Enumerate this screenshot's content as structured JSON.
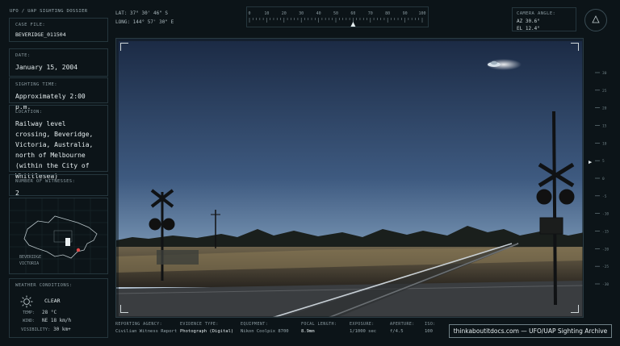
{
  "header": {
    "title": "UFO / UAP SIGHTING DOSSIER"
  },
  "fields": [
    {
      "label": "CASE FILE:",
      "value": "BEVERIDGE_011504"
    },
    {
      "label": "DATE:",
      "value": "January 15, 2004"
    },
    {
      "label": "SIGHTING TIME:",
      "value": "Approximately 2:00 p.m."
    },
    {
      "label": "LOCATION:",
      "value": "Railway level crossing, Beveridge, Victoria, Australia, north of Melbourne (within the City of Whittlesea)"
    },
    {
      "label": "NUMBER OF WITNESSES:",
      "value": "2"
    }
  ],
  "map": {
    "label_1": "BEVERIDGE",
    "label_2": "VICTORIA",
    "marker_color": "#e04848"
  },
  "weather": {
    "label": "WEATHER CONDITIONS:",
    "condition": "CLEAR",
    "temp_label": "TEMP:",
    "temp": "28 °C",
    "wind_label": "WIND:",
    "wind": "NE 18 km/h",
    "vis_label": "VISIBILITY:",
    "vis": "30 km+"
  },
  "coords": {
    "lat": "LAT: 37° 30' 46\" S",
    "long": "LONG: 144° 57' 30\" E"
  },
  "scale_ticks": [
    "0",
    "10",
    "20",
    "30",
    "40",
    "50",
    "60",
    "70",
    "80",
    "90",
    "100"
  ],
  "scale_pointer": 0.6,
  "camera": {
    "label": "CAMERA ANGLE:",
    "az": "AZ 30.6°",
    "el": "EL 12.4°"
  },
  "right_scale": [
    "30",
    "25",
    "20",
    "15",
    "10",
    "5",
    "0",
    "-5",
    "-10",
    "-15",
    "-20",
    "-25",
    "-30"
  ],
  "bottom": [
    {
      "label": "REPORTING AGENCY:",
      "value": "Civilian Witness Report"
    },
    {
      "label": "EVIDENCE TYPE:",
      "value": "Photograph (Digital)"
    },
    {
      "label": "EQUIPMENT:",
      "value": "Nikon Coolpix 8700"
    },
    {
      "label": "FOCAL LENGTH:",
      "value": "8.9mm"
    },
    {
      "label": "EXPOSURE:",
      "value": "1/1000 sec"
    },
    {
      "label": "APERTURE:",
      "value": "f/4.5"
    },
    {
      "label": "ISO:",
      "value": "100"
    }
  ],
  "archive": "thinkaboutitdocs.com — UFO/UAP Sighting Archive"
}
